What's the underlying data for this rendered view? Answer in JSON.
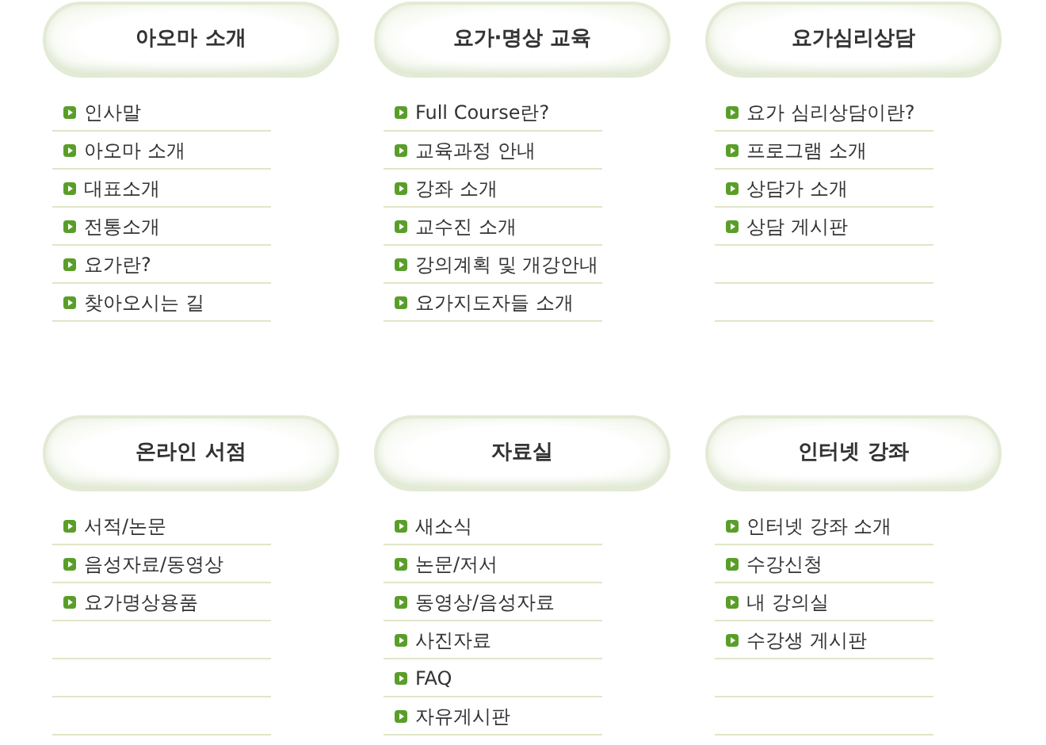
{
  "sections": [
    {
      "title": "아오마 소개",
      "items": [
        "인사말",
        "아오마 소개",
        "대표소개",
        "전통소개",
        "요가란?",
        "찾아오시는 길"
      ]
    },
    {
      "title": "요가·명상 교육",
      "items": [
        "Full Course란?",
        "교육과정 안내",
        "강좌 소개",
        "교수진 소개",
        "강의계획 및 개강안내",
        "요가지도자들 소개"
      ]
    },
    {
      "title": "요가심리상담",
      "items": [
        "요가 심리상담이란?",
        "프로그램 소개",
        "상담가 소개",
        "상담 게시판"
      ]
    },
    {
      "title": "온라인 서점",
      "items": [
        "서적/논문",
        "음성자료/동영상",
        "요가명상용품"
      ]
    },
    {
      "title": "자료실",
      "items": [
        "새소식",
        "논문/저서",
        "동영상/음성자료",
        "사진자료",
        "FAQ",
        "자유게시판"
      ]
    },
    {
      "title": "인터넷 강좌",
      "items": [
        "인터넷 강좌 소개",
        "수강신청",
        "내 강의실",
        "수강생 게시판"
      ]
    }
  ]
}
